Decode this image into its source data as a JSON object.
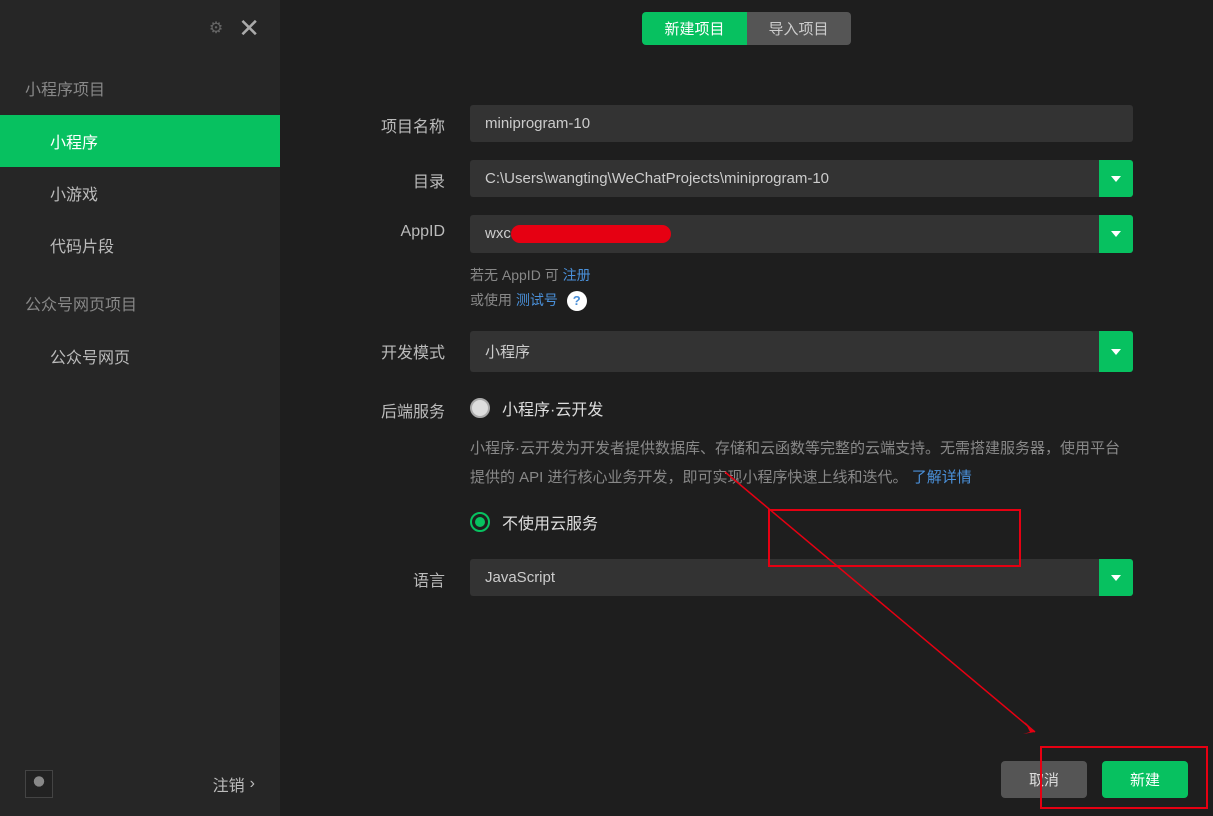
{
  "sidebar": {
    "section1_title": "小程序项目",
    "items1": [
      {
        "label": "小程序"
      },
      {
        "label": "小游戏"
      },
      {
        "label": "代码片段"
      }
    ],
    "section2_title": "公众号网页项目",
    "items2": [
      {
        "label": "公众号网页"
      }
    ],
    "logout": "注销"
  },
  "tabs": {
    "new": "新建项目",
    "import": "导入项目"
  },
  "form": {
    "name_label": "项目名称",
    "name_value": "miniprogram-10",
    "dir_label": "目录",
    "dir_value": "C:\\Users\\wangting\\WeChatProjects\\miniprogram-10",
    "appid_label": "AppID",
    "appid_value": "wxc",
    "appid_hint_prefix": "若无 AppID 可 ",
    "appid_register": "注册",
    "appid_or": "或使用 ",
    "appid_test": "测试号",
    "mode_label": "开发模式",
    "mode_value": "小程序",
    "backend_label": "后端服务",
    "backend_opt1": "小程序·云开发",
    "backend_desc": "小程序·云开发为开发者提供数据库、存储和云函数等完整的云端支持。无需搭建服务器，使用平台提供的 API 进行核心业务开发，即可实现小程序快速上线和迭代。",
    "backend_learn": "了解详情",
    "backend_opt2": "不使用云服务",
    "lang_label": "语言",
    "lang_value": "JavaScript"
  },
  "buttons": {
    "cancel": "取消",
    "create": "新建"
  }
}
